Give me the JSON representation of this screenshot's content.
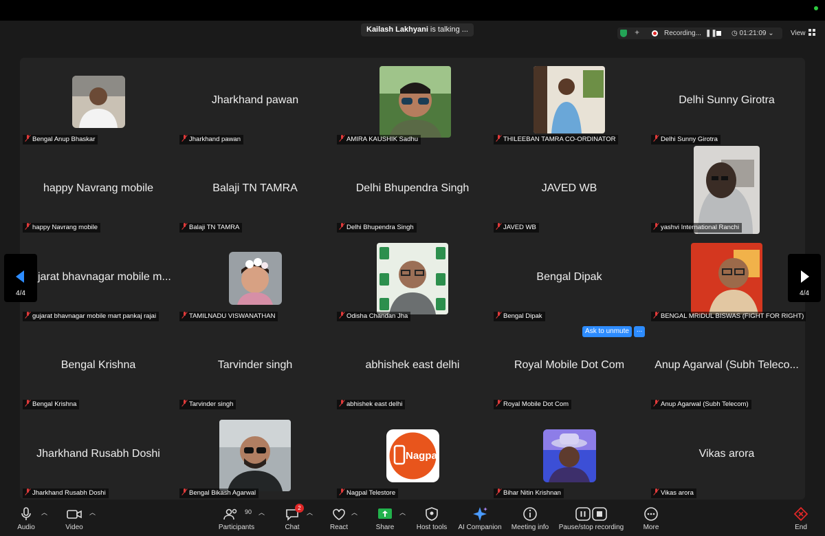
{
  "talking_banner": {
    "name": "Kailash Lakhyani",
    "suffix": " is talking ..."
  },
  "status_bar": {
    "recording_label": "Recording...",
    "timer": "01:21:09",
    "view_label": "View"
  },
  "pagination": {
    "left_page": "4/4",
    "right_page": "4/4"
  },
  "tiles": [
    {
      "center": "",
      "label": "Bengal Anup Bhaskar",
      "photo": "man-office"
    },
    {
      "center": "Jharkhand pawan",
      "label": "Jharkhand pawan"
    },
    {
      "center": "",
      "label": "AMIRA KAUSHIK Sadhu",
      "photo": "man-sunglasses"
    },
    {
      "center": "",
      "label": "THILEEBAN TAMRA CO-ORDINATOR",
      "photo": "man-plants"
    },
    {
      "center": "Delhi Sunny Girotra",
      "label": "Delhi Sunny Girotra"
    },
    {
      "center": "happy Navrang mobile",
      "label": "happy Navrang mobile"
    },
    {
      "center": "Balaji TN TAMRA",
      "label": "Balaji TN TAMRA"
    },
    {
      "center": "Delhi Bhupendra Singh",
      "label": "Delhi Bhupendra Singh"
    },
    {
      "center": "JAVED WB",
      "label": "JAVED WB"
    },
    {
      "center": "",
      "label": "yashvi International Ranchi",
      "photo": "man-hoodie"
    },
    {
      "center": "gujarat bhavnagar mobile m...",
      "label": "gujarat bhavnagar mobile mart pankaj rajai"
    },
    {
      "center": "",
      "label": "TAMILNADU VISWANATHAN",
      "photo": "child-flowers"
    },
    {
      "center": "",
      "label": "Odisha Chandan Jha",
      "photo": "man-banner"
    },
    {
      "center": "Bengal Dipak",
      "label": "Bengal Dipak"
    },
    {
      "center": "",
      "label": "BENGAL MRIDUL BISWAS (FIGHT FOR RIGHT)",
      "photo": "man-red"
    },
    {
      "center": "Bengal Krishna",
      "label": "Bengal Krishna"
    },
    {
      "center": "Tarvinder singh",
      "label": "Tarvinder singh"
    },
    {
      "center": "abhishek east delhi",
      "label": "abhishek east delhi"
    },
    {
      "center": "Royal Mobile Dot Com",
      "label": "Royal Mobile Dot Com"
    },
    {
      "center": "Anup Agarwal (Subh Teleco...",
      "label": "Anup Agarwal (Subh Telecom)"
    },
    {
      "center": "Jharkhand Rusabh Doshi",
      "label": "Jharkhand Rusabh Doshi"
    },
    {
      "center": "",
      "label": "Bengal Bikash Agarwal",
      "photo": "man-beard"
    },
    {
      "center": "",
      "label": "Nagpal Telestore",
      "photo": "nagpal-logo"
    },
    {
      "center": "",
      "label": "Bihar Nitin Krishnan",
      "photo": "man-hat"
    },
    {
      "center": "Vikas arora",
      "label": "Vikas arora"
    }
  ],
  "nagpal_logo_text": "Nagpal",
  "ask_unmute": {
    "label": "Ask to unmute",
    "more": "..."
  },
  "toolbar": {
    "audio": "Audio",
    "video": "Video",
    "participants": "Participants",
    "participant_count": "90",
    "chat": "Chat",
    "chat_badge": "2",
    "react": "React",
    "share": "Share",
    "host_tools": "Host tools",
    "ai_companion": "AI Companion",
    "meeting_info": "Meeting info",
    "pause_stop": "Pause/stop recording",
    "more": "More",
    "end": "End"
  },
  "colors": {
    "accent": "#2d8cff",
    "record": "#e02727",
    "shield": "#23a356",
    "share": "#22b24c",
    "end": "#e02727"
  }
}
